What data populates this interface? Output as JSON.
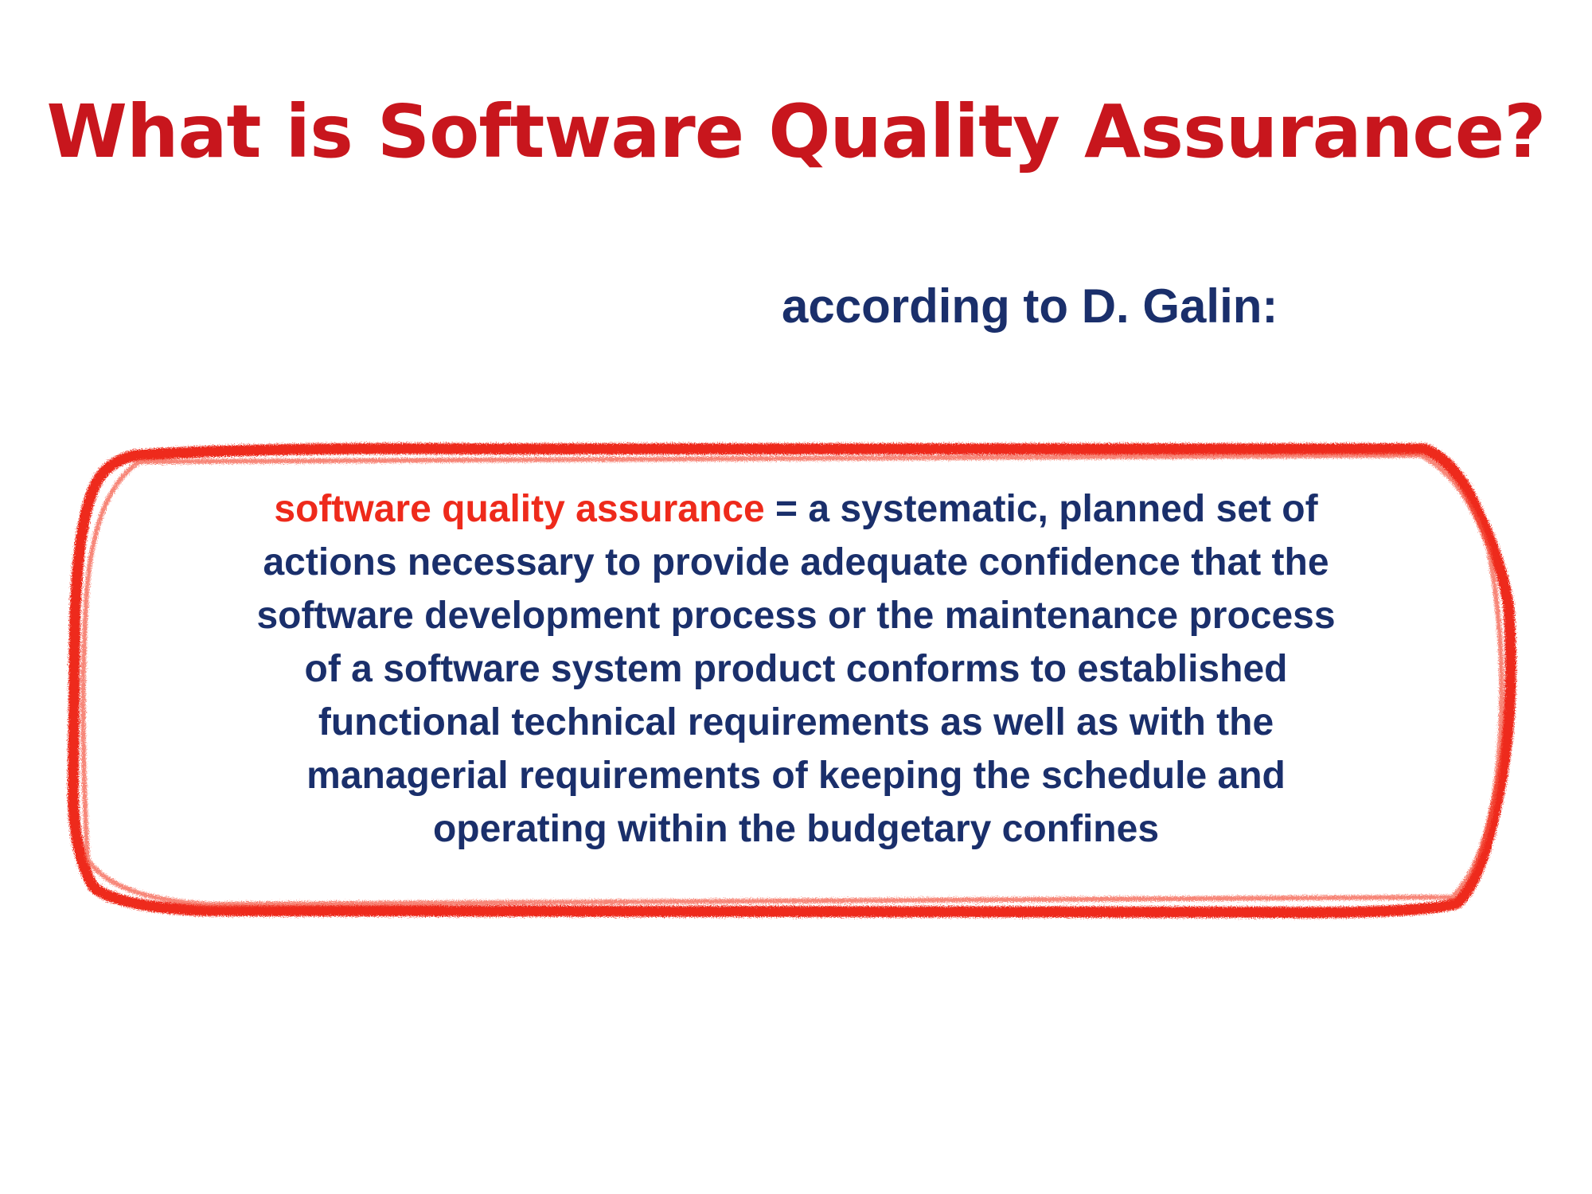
{
  "slide": {
    "title": "What is Software Quality Assurance?",
    "subtitle": "according to D. Galin:",
    "definition": {
      "term": "software quality assurance",
      "line1_rest": " = a systematic, planned set of",
      "lines": [
        "actions necessary to provide adequate confidence that the",
        "software development process or the maintenance process",
        "of a software system product conforms to established",
        "functional technical requirements as well as with the",
        "managerial requirements of keeping the schedule and",
        "operating within the budgetary confines"
      ]
    }
  },
  "colors": {
    "title": "#c8161d",
    "body_text": "#1a2f6b",
    "term": "#ee2a1b",
    "frame": "#ee2a1b"
  }
}
